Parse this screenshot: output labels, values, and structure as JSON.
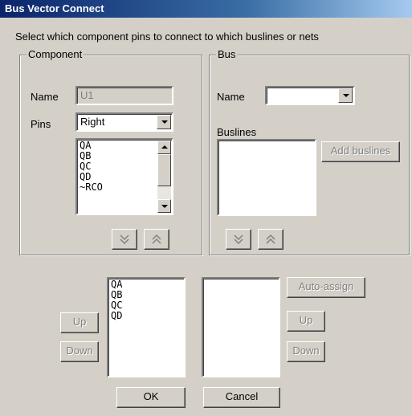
{
  "window": {
    "title": "Bus Vector Connect"
  },
  "instruction": "Select which component pins to connect to which buslines or nets",
  "component": {
    "legend": "Component",
    "name_label": "Name",
    "name_value": "U1",
    "pins_label": "Pins",
    "pins_value": "Right",
    "pin_list": [
      "QA",
      "QB",
      "QC",
      "QD",
      "~RCO"
    ]
  },
  "bus": {
    "legend": "Bus",
    "name_label": "Name",
    "name_value": "",
    "buslines_label": "Buslines",
    "add_buslines_label": "Add buslines",
    "buslines": []
  },
  "selected_pins": [
    "QA",
    "QB",
    "QC",
    "QD"
  ],
  "selected_buslines": [],
  "buttons": {
    "up_left": "Up",
    "down_left": "Down",
    "auto_assign": "Auto-assign",
    "up_right": "Up",
    "down_right": "Down",
    "ok": "OK",
    "cancel": "Cancel"
  },
  "icons": {
    "move_down": "double-chevron-down-icon",
    "move_up": "double-chevron-up-icon",
    "dropdown": "dropdown-arrow-icon"
  }
}
